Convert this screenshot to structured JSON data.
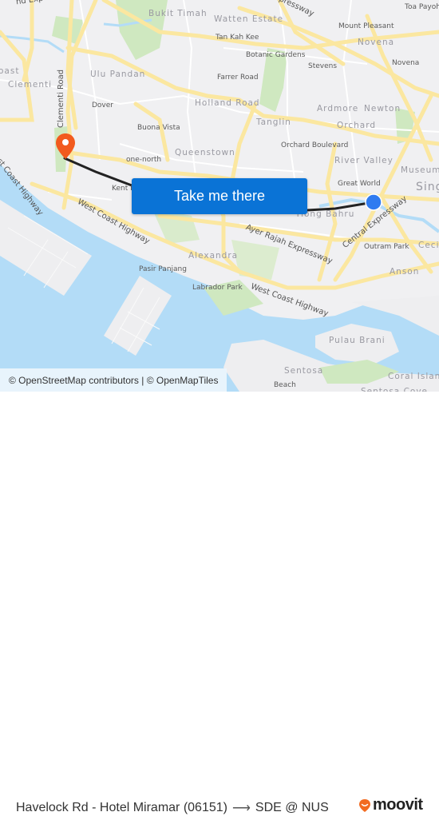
{
  "map": {
    "colors": {
      "land": "#f0f0f2",
      "water": "#b3dcf7",
      "park": "#cfe8c0",
      "road_major": "#fbe7a0",
      "road_minor": "#ffffff",
      "route_line": "#222222",
      "origin_marker": "#2f7bf0",
      "destination_marker": "#f25a1e"
    },
    "labels": {
      "bukit_timah": "Bukit Timah",
      "watten_estate": "Watten Estate",
      "tan_kah_kee": "Tan Kah Kee",
      "expressway_top": "Expressway",
      "toa_payoh": "Toa Payoh",
      "mount_pleasant": "Mount Pleasant",
      "novena_area": "Novena",
      "novena": "Novena",
      "botanic_gardens": "Botanic Gardens",
      "stevens": "Stevens",
      "farrer_road": "Farrer Road",
      "ulu_pandan": "Ulu Pandan",
      "clementi": "Clementi",
      "coast": "oast",
      "island_expressway": "nd Exp",
      "dover": "Dover",
      "holland_road": "Holland Road",
      "ardmore": "Ardmore",
      "newton": "Newton",
      "buona_vista": "Buona Vista",
      "tanglin": "Tanglin",
      "orchard": "Orchard",
      "queenstown": "Queenstown",
      "orchard_boulevard": "Orchard Boulevard",
      "one_north": "one-north",
      "river_valley": "River Valley",
      "museum": "Museum",
      "singapore": "Sing",
      "great_world": "Great World",
      "kent_ridge": "Kent R",
      "tiong_bahru": "Tiong Bahru",
      "west_coast_highway_1": "West Coast Highway",
      "west_coast_highway_2": "West Coast Highway",
      "west_coast_highway_3": "West Coast Highway",
      "clementi_road": "Clementi Road",
      "ayer_rajah_expressway": "Ayer Rajah Expressway",
      "central_expressway": "Central Expressway",
      "outram_park": "Outram Park",
      "cecil": "Ceci",
      "anson": "Anson",
      "alexandra": "Alexandra",
      "pasir_panjang": "Pasir Panjang",
      "labrador_park": "Labrador Park",
      "pulau_brani": "Pulau Brani",
      "sentosa": "Sentosa",
      "beach": "Beach",
      "coral_island": "Coral Island",
      "sentosa_cove": "Sentosa Cove"
    },
    "origin_marker_icon": "blue-dot-icon",
    "destination_marker_icon": "map-pin-icon"
  },
  "cta": {
    "label": "Take me there"
  },
  "attribution": {
    "text": "© OpenStreetMap contributors | © OpenMapTiles"
  },
  "footer": {
    "origin": "Havelock Rd - Hotel Miramar (06151)",
    "arrow_icon": "arrow-right-icon",
    "destination": "SDE @ NUS",
    "brand": "moovit",
    "brand_color": "#f26b21"
  }
}
